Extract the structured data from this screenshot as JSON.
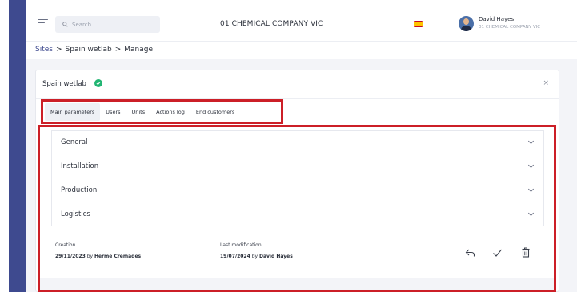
{
  "topbar": {
    "search_placeholder": "Search...",
    "company_title": "01 CHEMICAL COMPANY VIC",
    "flag_icon": "spain-flag-icon",
    "user_name": "David Hayes",
    "user_company": "01 CHEMICAL COMPANY VIC"
  },
  "breadcrumb": {
    "items": [
      "Sites",
      ">",
      "Spain wetlab",
      ">",
      "Manage"
    ]
  },
  "card": {
    "title": "Spain wetlab",
    "verified_icon": "check-circle-icon",
    "close_label": "×"
  },
  "tabs": [
    "Main parameters",
    "Users",
    "Units",
    "Actions log",
    "End customers"
  ],
  "active_tab": "Main parameters",
  "sections": [
    "General",
    "Installation",
    "Production",
    "Logistics"
  ],
  "creation": {
    "label": "Creation",
    "date": "29/11/2023",
    "by": "by",
    "author": "Herme Cremades"
  },
  "modification": {
    "label": "Last modification",
    "date": "19/07/2024",
    "by": "by",
    "author": "David Hayes"
  },
  "actions": [
    "undo-icon",
    "check-icon",
    "trash-icon"
  ],
  "colors": {
    "sidebar": "#3e4a8f",
    "highlight": "#cc1f27",
    "verified": "#22b573",
    "link": "#3e4a8f"
  }
}
